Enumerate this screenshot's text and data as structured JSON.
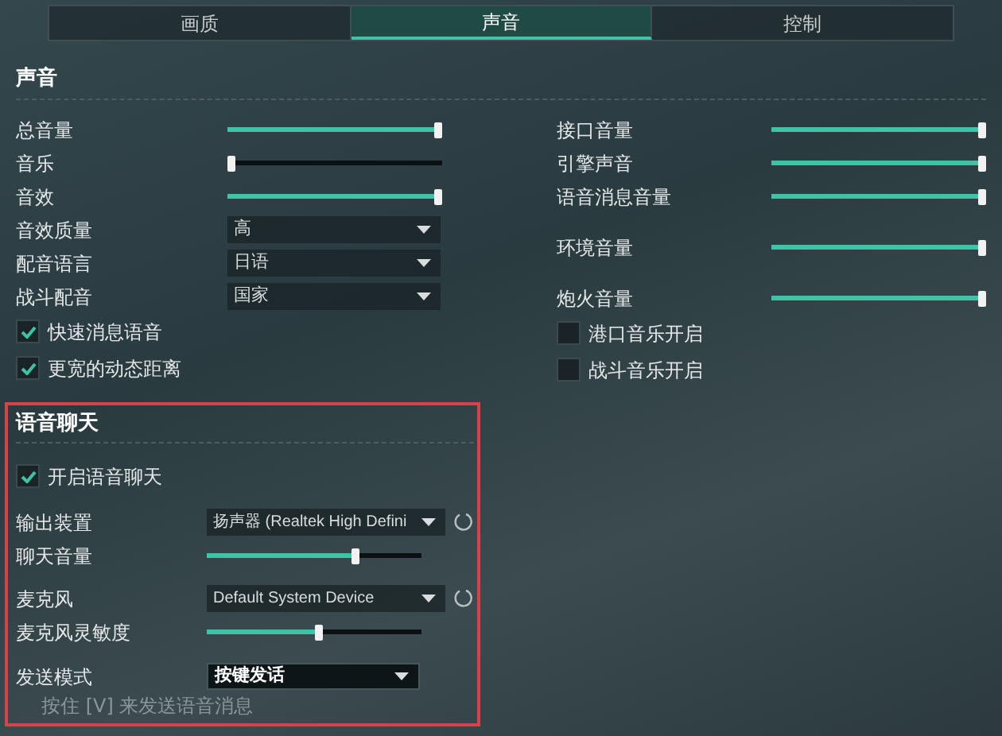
{
  "tabs": [
    {
      "label": "画质",
      "selected": false
    },
    {
      "label": "声音",
      "selected": true
    },
    {
      "label": "控制",
      "selected": false
    }
  ],
  "sound": {
    "title": "声音",
    "left": [
      {
        "kind": "slider",
        "label": "总音量",
        "level": 1
      },
      {
        "kind": "slider",
        "label": "音乐",
        "level": 0
      },
      {
        "kind": "slider",
        "label": "音效",
        "level": 1
      },
      {
        "kind": "select",
        "label": "音效质量",
        "value": "高"
      },
      {
        "kind": "select",
        "label": "配音语言",
        "value": "日语"
      },
      {
        "kind": "select",
        "label": "战斗配音",
        "value": "国家"
      },
      {
        "kind": "checkbox",
        "label": "快速消息语音",
        "checked": true
      },
      {
        "kind": "checkbox",
        "label": "更宽的动态距离",
        "checked": true
      }
    ],
    "right": [
      {
        "kind": "slider",
        "label": "接口音量",
        "level": 1
      },
      {
        "kind": "slider",
        "label": "引擎声音",
        "level": 1
      },
      {
        "kind": "slider",
        "label": "语音消息音量",
        "level": 1
      },
      {
        "kind": "slider",
        "label": "环境音量",
        "level": 1
      },
      {
        "kind": "slider",
        "label": "炮火音量",
        "level": 1
      },
      {
        "kind": "checkbox",
        "label": "港口音乐开启",
        "checked": false
      },
      {
        "kind": "checkbox",
        "label": "战斗音乐开启",
        "checked": false
      }
    ]
  },
  "voice_chat": {
    "title": "语音聊天",
    "items": [
      {
        "kind": "checkbox",
        "label": "开启语音聊天",
        "checked": true
      },
      {
        "kind": "device",
        "label": "输出装置",
        "value": "扬声器 (Realtek High Defini"
      },
      {
        "kind": "slider",
        "label": "聊天音量",
        "level": 0.7
      },
      {
        "kind": "device",
        "label": "麦克风",
        "value": "Default System Device"
      },
      {
        "kind": "slider",
        "label": "麦克风灵敏度",
        "level": 0.52
      },
      {
        "kind": "select",
        "label": "发送模式",
        "value": "按键发话"
      }
    ],
    "hint": "按住 [V] 来发送语音消息"
  }
}
